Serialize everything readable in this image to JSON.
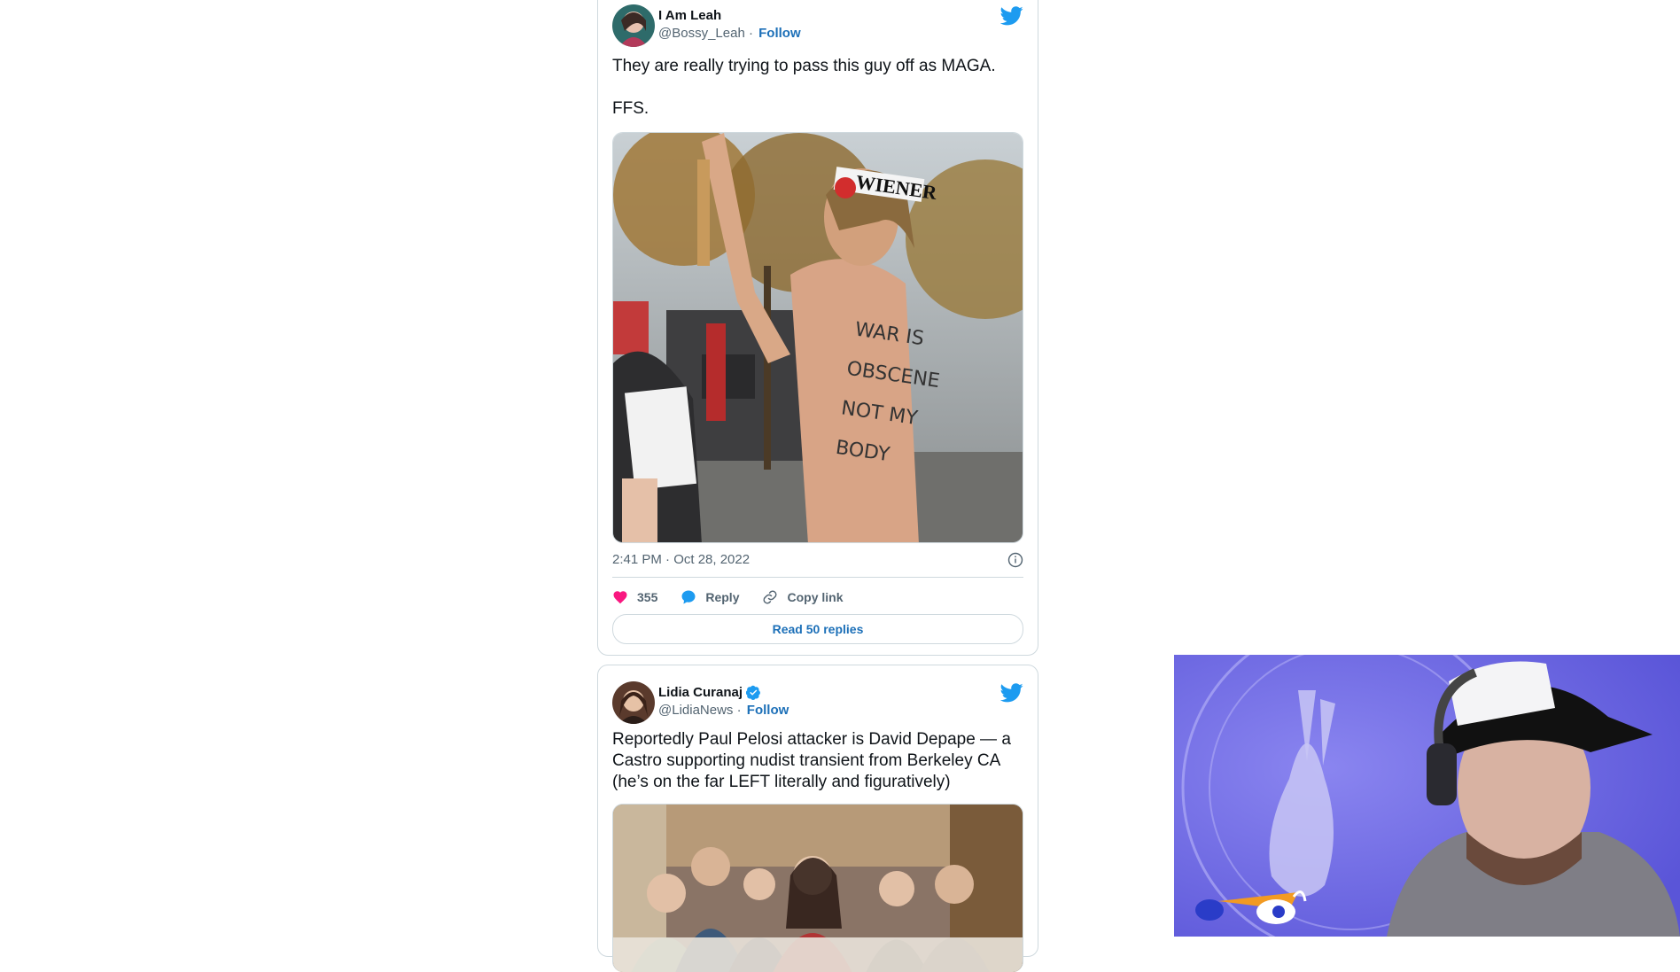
{
  "tweets": [
    {
      "author_name": "I Am Leah",
      "handle": "@Bossy_Leah",
      "separator": "·",
      "follow_label": "Follow",
      "text_line1": "They are really trying to pass this guy off as MAGA.",
      "text_line2": "FFS.",
      "timestamp": "2:41 PM · Oct 28, 2022",
      "likes": "355",
      "reply_label": "Reply",
      "copy_label": "Copy link",
      "read_replies_label": "Read 50 replies",
      "image_sign_text": "WIENER",
      "image_body_text": "WAR IS OBSCENE NOT MY BODY"
    },
    {
      "author_name": "Lidia Curanaj",
      "handle": "@LidiaNews",
      "separator": "·",
      "follow_label": "Follow",
      "text": "Reportedly Paul Pelosi attacker is David Depape — a Castro supporting nudist transient from Berkeley CA (he’s on the far LEFT literally and figuratively)"
    }
  ],
  "colors": {
    "link": "#1d70b8",
    "twitter_blue": "#1d9bf0",
    "heart": "#f91880",
    "border": "#cfd9de"
  },
  "icons": [
    "twitter-bird-icon",
    "heart-icon",
    "reply-bubble-icon",
    "link-icon",
    "info-icon",
    "verified-badge-icon"
  ]
}
